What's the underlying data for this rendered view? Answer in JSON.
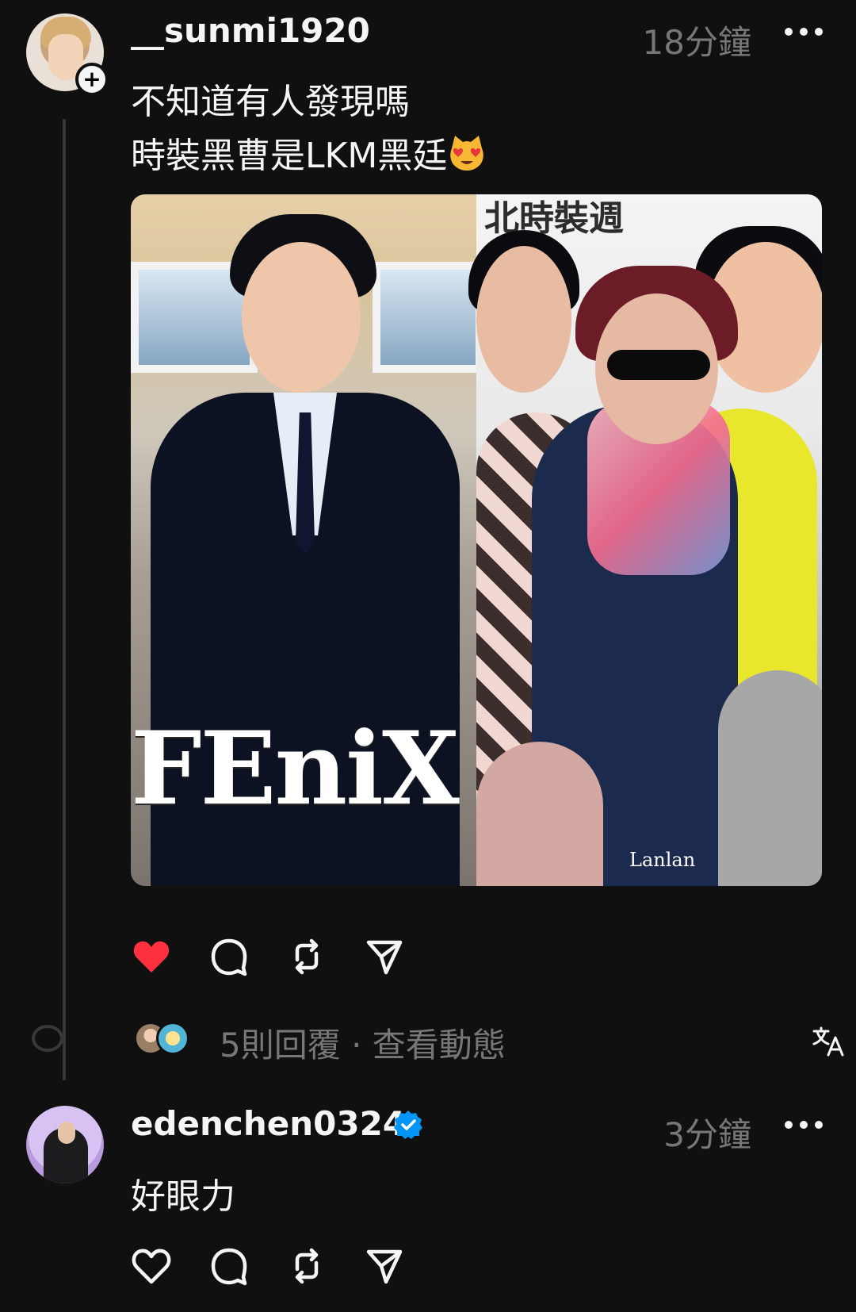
{
  "posts": [
    {
      "username": "__sunmi1920",
      "time": "18分鐘",
      "caption_line1": "不知道有人發現嗎",
      "caption_line2": "時裝黑曹是LKM黑廷",
      "caption_emoji": "smiling-cat-heart-eyes",
      "media": {
        "left_image_text": "FEniX",
        "right_image_sign": "北時裝週",
        "photo_credit": "Lanlan"
      },
      "liked": true,
      "replies_summary": "5則回覆 · 查看動態"
    },
    {
      "username": "edenchen0324",
      "verified": true,
      "time": "3分鐘",
      "caption": "好眼力",
      "liked": false
    }
  ],
  "icons": {
    "like": "heart-icon",
    "comment": "comment-icon",
    "repost": "repost-icon",
    "share": "share-icon",
    "more": "more-icon",
    "translate": "translate-icon",
    "verified": "verified-icon",
    "follow": "follow-plus-icon"
  },
  "colors": {
    "background": "#101010",
    "text_primary": "#f3f5f7",
    "text_secondary": "#777777",
    "like_red": "#ff3040",
    "verified_blue": "#0095f6",
    "thread_line": "#383838"
  }
}
